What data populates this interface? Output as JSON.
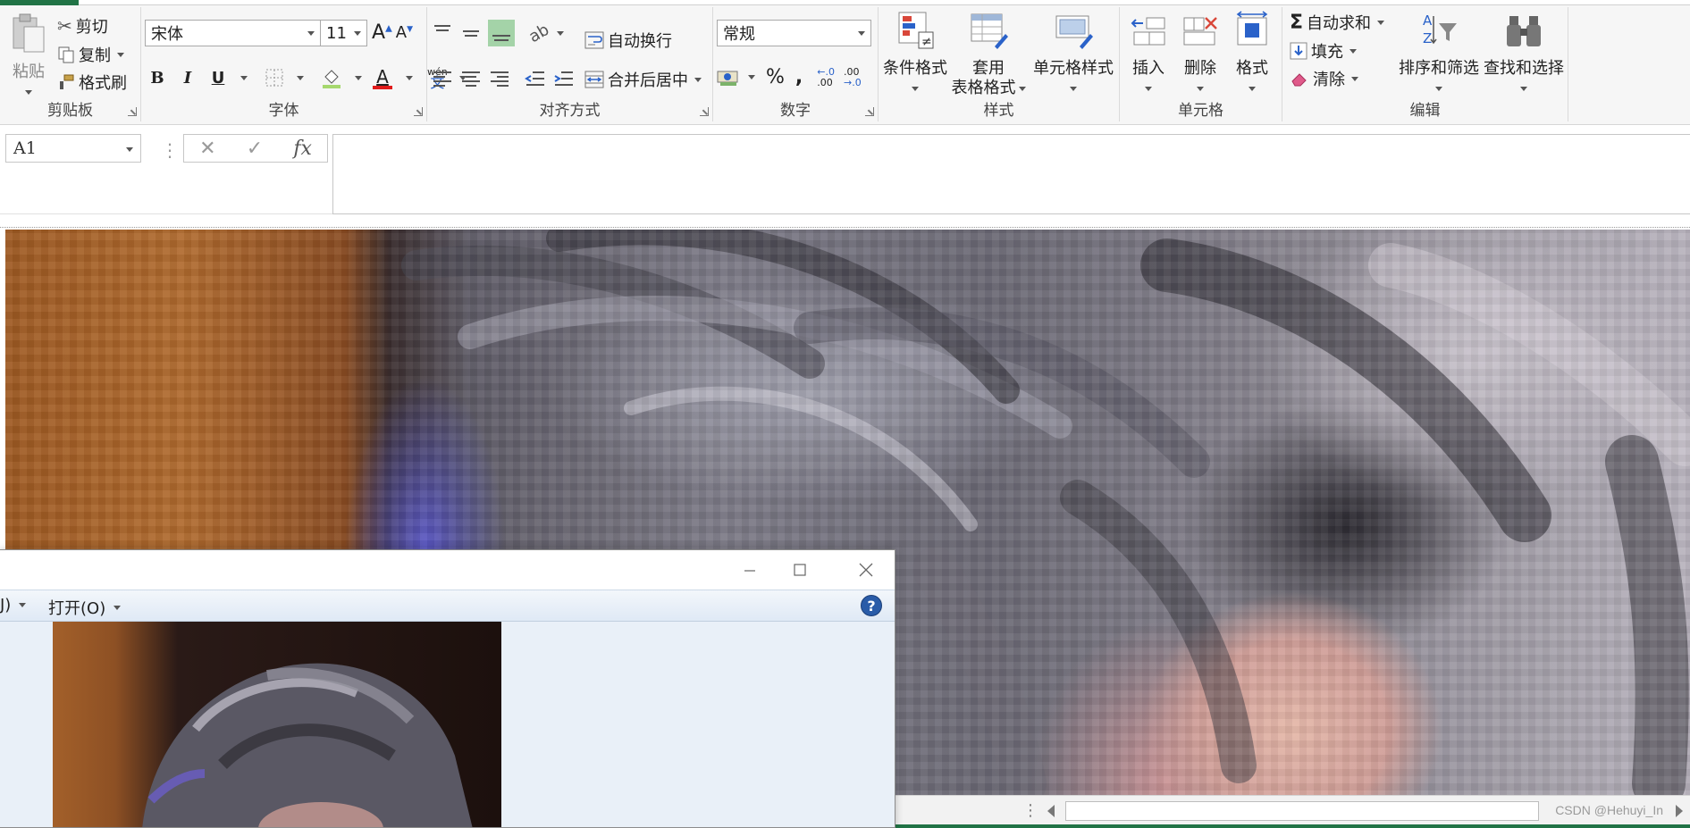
{
  "clipboard": {
    "paste": "粘贴",
    "cut": "剪切",
    "copy": "复制",
    "format_painter": "格式刷",
    "label": "剪贴板"
  },
  "font": {
    "name": "宋体",
    "size": "11",
    "bold": "B",
    "italic": "I",
    "underline": "U",
    "font_color_glyph": "A",
    "phonetic_top": "wén",
    "phonetic_bottom": "文",
    "label": "字体"
  },
  "alignment": {
    "wrap_text": "自动换行",
    "merge_center": "合并后居中",
    "label": "对齐方式"
  },
  "number": {
    "format": "常规",
    "percent": "%",
    "comma": ",",
    "inc_decimal_top": "←.0",
    "inc_decimal_bottom": ".00",
    "dec_decimal_top": ".00",
    "dec_decimal_bottom": "→.0",
    "label": "数字"
  },
  "styles": {
    "conditional": "条件格式",
    "table_line1": "套用",
    "table_line2": "表格格式",
    "cell_styles": "单元格样式",
    "label": "样式"
  },
  "cells": {
    "insert": "插入",
    "delete": "删除",
    "format": "格式",
    "label": "单元格"
  },
  "editing": {
    "autosum_symbol": "Σ",
    "autosum": "自动求和",
    "fill": "填充",
    "clear": "清除",
    "sort_filter": "排序和筛选",
    "find_select": "查找和选择",
    "label": "编辑"
  },
  "formula_bar": {
    "name_box": "A1",
    "cancel": "✕",
    "enter": "✓",
    "fx": "fx",
    "separator": "⋮"
  },
  "viewer": {
    "toolbar_partial": "J)",
    "open": "打开(O)",
    "help": "?"
  },
  "status": {
    "dots": "⋮",
    "watermark": "CSDN @Hehuyi_In"
  }
}
